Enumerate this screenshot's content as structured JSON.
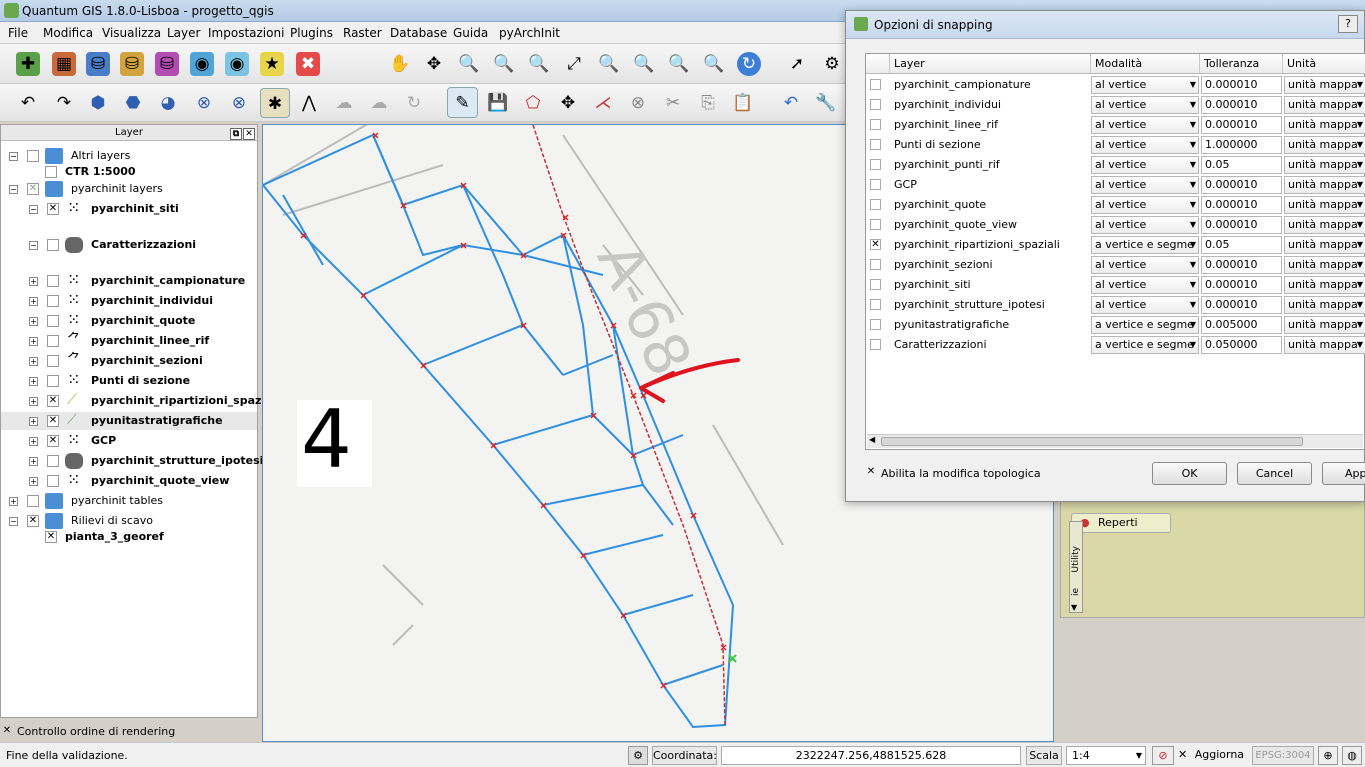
{
  "window": {
    "title": "Quantum GIS 1.8.0-Lisboa - progetto_qgis"
  },
  "menu": [
    "File",
    "Modifica",
    "Visualizza",
    "Layer",
    "Impostazioni",
    "Plugins",
    "Raster",
    "Database",
    "Guida",
    "pyArchInit"
  ],
  "layers_panel": {
    "title": "Layer",
    "items": [
      {
        "label": "Altri layers",
        "bold": false
      },
      {
        "label": "CTR 1:5000",
        "bold": true
      },
      {
        "label": "pyarchinit layers",
        "bold": false
      },
      {
        "label": "pyarchinit_siti",
        "bold": true
      },
      {
        "label": "Caratterizzazioni",
        "bold": true
      },
      {
        "label": "pyarchinit_campionature",
        "bold": true
      },
      {
        "label": "pyarchinit_individui",
        "bold": true
      },
      {
        "label": "pyarchinit_quote",
        "bold": true
      },
      {
        "label": "pyarchinit_linee_rif",
        "bold": true
      },
      {
        "label": "pyarchinit_sezioni",
        "bold": true
      },
      {
        "label": "Punti di sezione",
        "bold": true
      },
      {
        "label": "pyarchinit_ripartizioni_spaziali",
        "bold": true
      },
      {
        "label": "pyunitastratigrafiche",
        "bold": true
      },
      {
        "label": "GCP",
        "bold": true
      },
      {
        "label": "pyarchinit_strutture_ipotesi",
        "bold": true
      },
      {
        "label": "pyarchinit_quote_view",
        "bold": true
      },
      {
        "label": "pyarchinit tables",
        "bold": false
      },
      {
        "label": "Rilievi di scavo",
        "bold": false
      },
      {
        "label": "pianta_3_georef",
        "bold": true
      }
    ],
    "render_order_label": "Controllo ordine di rendering"
  },
  "map": {
    "overlay_number": "4"
  },
  "snapping_dialog": {
    "title": "Opzioni di snapping",
    "help": "?",
    "columns": [
      "Layer",
      "Modalità",
      "Tolleranza",
      "Unità"
    ],
    "rows": [
      {
        "layer": "pyarchinit_campionature",
        "mode": "al vertice",
        "tol": "0.000010",
        "unit": "unità mappa",
        "checked": false
      },
      {
        "layer": "pyarchinit_individui",
        "mode": "al vertice",
        "tol": "0.000010",
        "unit": "unità mappa",
        "checked": false
      },
      {
        "layer": "pyarchinit_linee_rif",
        "mode": "al vertice",
        "tol": "0.000010",
        "unit": "unità mappa",
        "checked": false
      },
      {
        "layer": "Punti di sezione",
        "mode": "al vertice",
        "tol": "1.000000",
        "unit": "unità mappa",
        "checked": false
      },
      {
        "layer": "pyarchinit_punti_rif",
        "mode": "al vertice",
        "tol": "0.05",
        "unit": "unità mappa",
        "checked": false
      },
      {
        "layer": "GCP",
        "mode": "al vertice",
        "tol": "0.000010",
        "unit": "unità mappa",
        "checked": false
      },
      {
        "layer": "pyarchinit_quote",
        "mode": "al vertice",
        "tol": "0.000010",
        "unit": "unità mappa",
        "checked": false
      },
      {
        "layer": "pyarchinit_quote_view",
        "mode": "al vertice",
        "tol": "0.000010",
        "unit": "unità mappa",
        "checked": false
      },
      {
        "layer": "pyarchinit_ripartizioni_spaziali",
        "mode": "a vertice e segme",
        "tol": "0.05",
        "unit": "unità mappa",
        "checked": true
      },
      {
        "layer": "pyarchinit_sezioni",
        "mode": "al vertice",
        "tol": "0.000010",
        "unit": "unità mappa",
        "checked": false
      },
      {
        "layer": "pyarchinit_siti",
        "mode": "al vertice",
        "tol": "0.000010",
        "unit": "unità mappa",
        "checked": false
      },
      {
        "layer": "pyarchinit_strutture_ipotesi",
        "mode": "al vertice",
        "tol": "0.000010",
        "unit": "unità mappa",
        "checked": false
      },
      {
        "layer": "pyunitastratigrafiche",
        "mode": "a vertice e segme",
        "tol": "0.005000",
        "unit": "unità mappa",
        "checked": false
      },
      {
        "layer": "Caratterizzazioni",
        "mode": "a vertice e segme",
        "tol": "0.050000",
        "unit": "unità mappa",
        "checked": false
      }
    ],
    "topological_label": "Abilita la modifica topologica",
    "ok": "OK",
    "cancel": "Cancel",
    "apply": "App"
  },
  "dock": {
    "button": "Reperti",
    "tab1": "Utility",
    "tab2": "ie"
  },
  "status": {
    "message": "Fine della validazione.",
    "coord_label": "Coordinata:",
    "coord_value": "2322247.256,4881525.628",
    "scale_label": "Scala",
    "scale_value": "1:4",
    "render_label": "Aggiorna",
    "epsg": "EPSG:3004"
  },
  "colors": {
    "accent": "#3d8fd6",
    "snap_mark": "#e02020",
    "annotation": "#e0141e"
  }
}
